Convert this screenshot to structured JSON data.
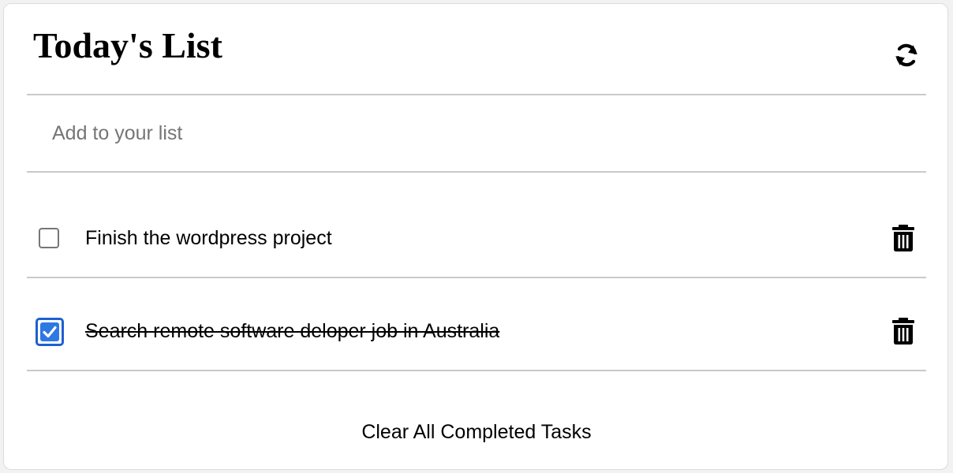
{
  "header": {
    "title": "Today's List",
    "refresh_icon": "refresh-icon"
  },
  "add_input": {
    "placeholder": "Add to your list",
    "value": ""
  },
  "tasks": [
    {
      "label": "Finish the wordpress project",
      "completed": false,
      "delete_icon": "trash-icon"
    },
    {
      "label": "Search remote software deloper job in Australia ",
      "completed": true,
      "delete_icon": "trash-icon"
    }
  ],
  "footer": {
    "clear_label": "Clear All Completed Tasks"
  },
  "colors": {
    "checkbox_accent": "#2f78e3",
    "divider": "#c9c9c9"
  }
}
